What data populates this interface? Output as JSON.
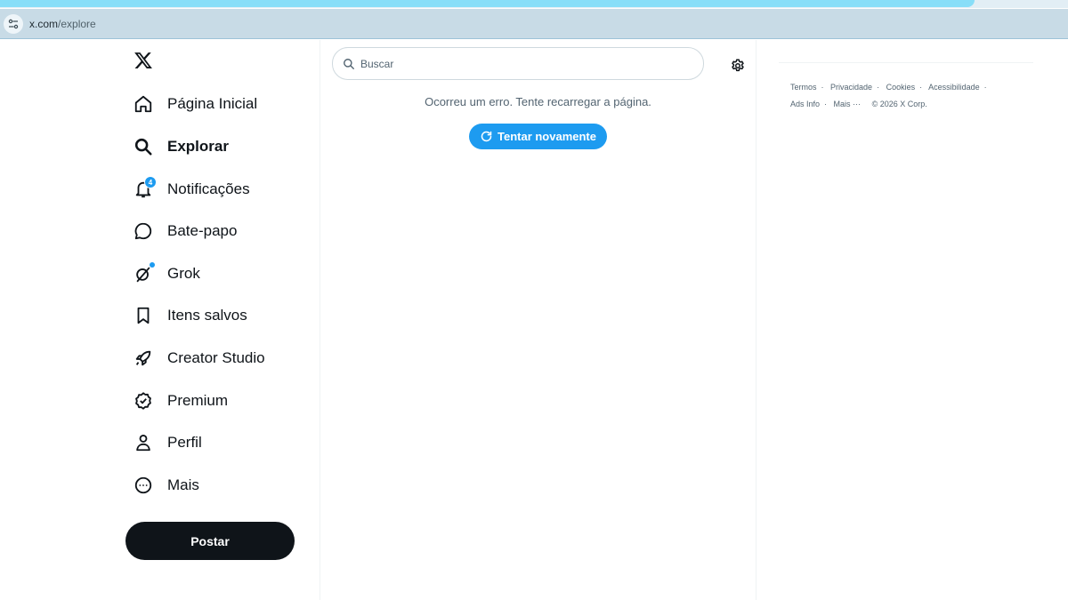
{
  "browser": {
    "url_host": "x.com",
    "url_path": "/explore"
  },
  "nav": {
    "items": [
      {
        "label": "Página Inicial",
        "icon": "home-icon"
      },
      {
        "label": "Explorar",
        "icon": "search-icon",
        "active": true
      },
      {
        "label": "Notificações",
        "icon": "bell-icon",
        "badge": "4"
      },
      {
        "label": "Bate-papo",
        "icon": "chat-bubble-icon"
      },
      {
        "label": "Grok",
        "icon": "grok-icon"
      },
      {
        "label": "Itens salvos",
        "icon": "bookmark-icon"
      },
      {
        "label": "Creator Studio",
        "icon": "rocket-icon"
      },
      {
        "label": "Premium",
        "icon": "verified-badge-icon"
      },
      {
        "label": "Perfil",
        "icon": "person-icon"
      },
      {
        "label": "Mais",
        "icon": "more-circle-icon"
      }
    ],
    "post_label": "Postar"
  },
  "main": {
    "search_placeholder": "Buscar",
    "error_message": "Ocorreu um erro. Tente recarregar a página.",
    "retry_label": "Tentar novamente"
  },
  "footer": {
    "links": [
      "Termos",
      "Privacidade",
      "Cookies",
      "Acessibilidade",
      "Ads Info",
      "Mais ···"
    ],
    "separator": "·",
    "copyright": "© 2026 X Corp."
  },
  "colors": {
    "accent": "#1d9bf0",
    "text_primary": "#0f1419",
    "text_secondary": "#536471",
    "post_button_bg": "#0f1419"
  }
}
